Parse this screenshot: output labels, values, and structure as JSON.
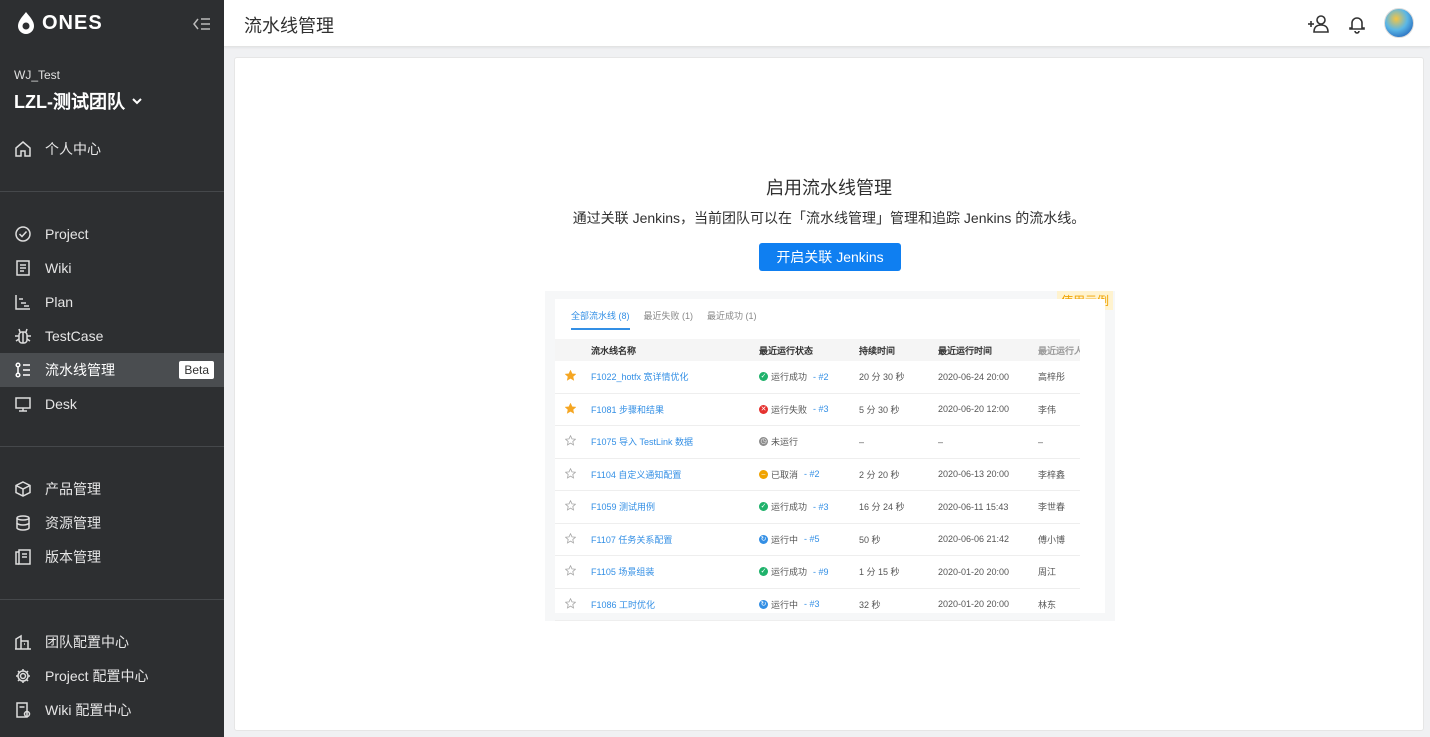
{
  "brand": {
    "logo_text": "ONES"
  },
  "sidebar": {
    "org": "WJ_Test",
    "team": "LZL-测试团队",
    "personal": "个人中心",
    "apps": [
      {
        "label": "Project",
        "icon": "check-circle-icon"
      },
      {
        "label": "Wiki",
        "icon": "wiki-icon"
      },
      {
        "label": "Plan",
        "icon": "plan-icon"
      },
      {
        "label": "TestCase",
        "icon": "bug-icon"
      },
      {
        "label": "流水线管理",
        "icon": "pipeline-icon",
        "active": true,
        "badge": "Beta"
      },
      {
        "label": "Desk",
        "icon": "desk-icon"
      }
    ],
    "products": [
      {
        "label": "产品管理",
        "icon": "product-icon"
      },
      {
        "label": "资源管理",
        "icon": "database-icon"
      },
      {
        "label": "版本管理",
        "icon": "version-icon"
      }
    ],
    "config": [
      {
        "label": "团队配置中心",
        "icon": "building-icon"
      },
      {
        "label": "Project 配置中心",
        "icon": "gear-icon"
      },
      {
        "label": "Wiki 配置中心",
        "icon": "wiki-config-icon"
      }
    ]
  },
  "header": {
    "title": "流水线管理"
  },
  "main": {
    "title": "启用流水线管理",
    "description": "通过关联 Jenkins，当前团队可以在「流水线管理」管理和追踪 Jenkins 的流水线。",
    "button": "开启关联 Jenkins"
  },
  "example": {
    "badge": "使用示例",
    "tabs": [
      "全部流水线 (8)",
      "最近失败 (1)",
      "最近成功 (1)"
    ],
    "columns": [
      "流水线名称",
      "最近运行状态",
      "持续时间",
      "最近运行时间",
      "最近运行人"
    ],
    "rows": [
      {
        "star": true,
        "name": "F1022_hotfx 宽详情优化",
        "status": "运行成功",
        "status_type": "success",
        "run": "- #2",
        "duration": "20 分 30 秒",
        "time": "2020-06-24 20:00",
        "user": "高梓彤"
      },
      {
        "star": true,
        "name": "F1081 步骤和结果",
        "status": "运行失败",
        "status_type": "fail",
        "run": "- #3",
        "duration": "5 分 30 秒",
        "time": "2020-06-20 12:00",
        "user": "李伟"
      },
      {
        "star": false,
        "name": "F1075 导入 TestLink 数据",
        "status": "未运行",
        "status_type": "none",
        "run": "",
        "duration": "–",
        "time": "–",
        "user": "–"
      },
      {
        "star": false,
        "name": "F1104 自定义通知配置",
        "status": "已取消",
        "status_type": "cancel",
        "run": "- #2",
        "duration": "2 分 20 秒",
        "time": "2020-06-13 20:00",
        "user": "李梓鑫"
      },
      {
        "star": false,
        "name": "F1059 测试用例",
        "status": "运行成功",
        "status_type": "success",
        "run": "- #3",
        "duration": "16 分 24 秒",
        "time": "2020-06-11 15:43",
        "user": "李世春"
      },
      {
        "star": false,
        "name": "F1107 任务关系配置",
        "status": "运行中",
        "status_type": "running",
        "run": "- #5",
        "duration": "50 秒",
        "time": "2020-06-06 21:42",
        "user": "傅小博"
      },
      {
        "star": false,
        "name": "F1105 场景组装",
        "status": "运行成功",
        "status_type": "success",
        "run": "- #9",
        "duration": "1 分 15 秒",
        "time": "2020-01-20 20:00",
        "user": "周江"
      },
      {
        "star": false,
        "name": "F1086 工时优化",
        "status": "运行中",
        "status_type": "running",
        "run": "- #3",
        "duration": "32 秒",
        "time": "2020-01-20 20:00",
        "user": "林东"
      }
    ]
  },
  "colors": {
    "primary": "#0f7ff1",
    "sidebar_bg": "#2d2f31",
    "sidebar_active": "#4a4d50",
    "success": "#1fb26b",
    "fail": "#e5312f",
    "cancel": "#f0a300",
    "running": "#338fe5",
    "none": "#8c8c8c"
  }
}
